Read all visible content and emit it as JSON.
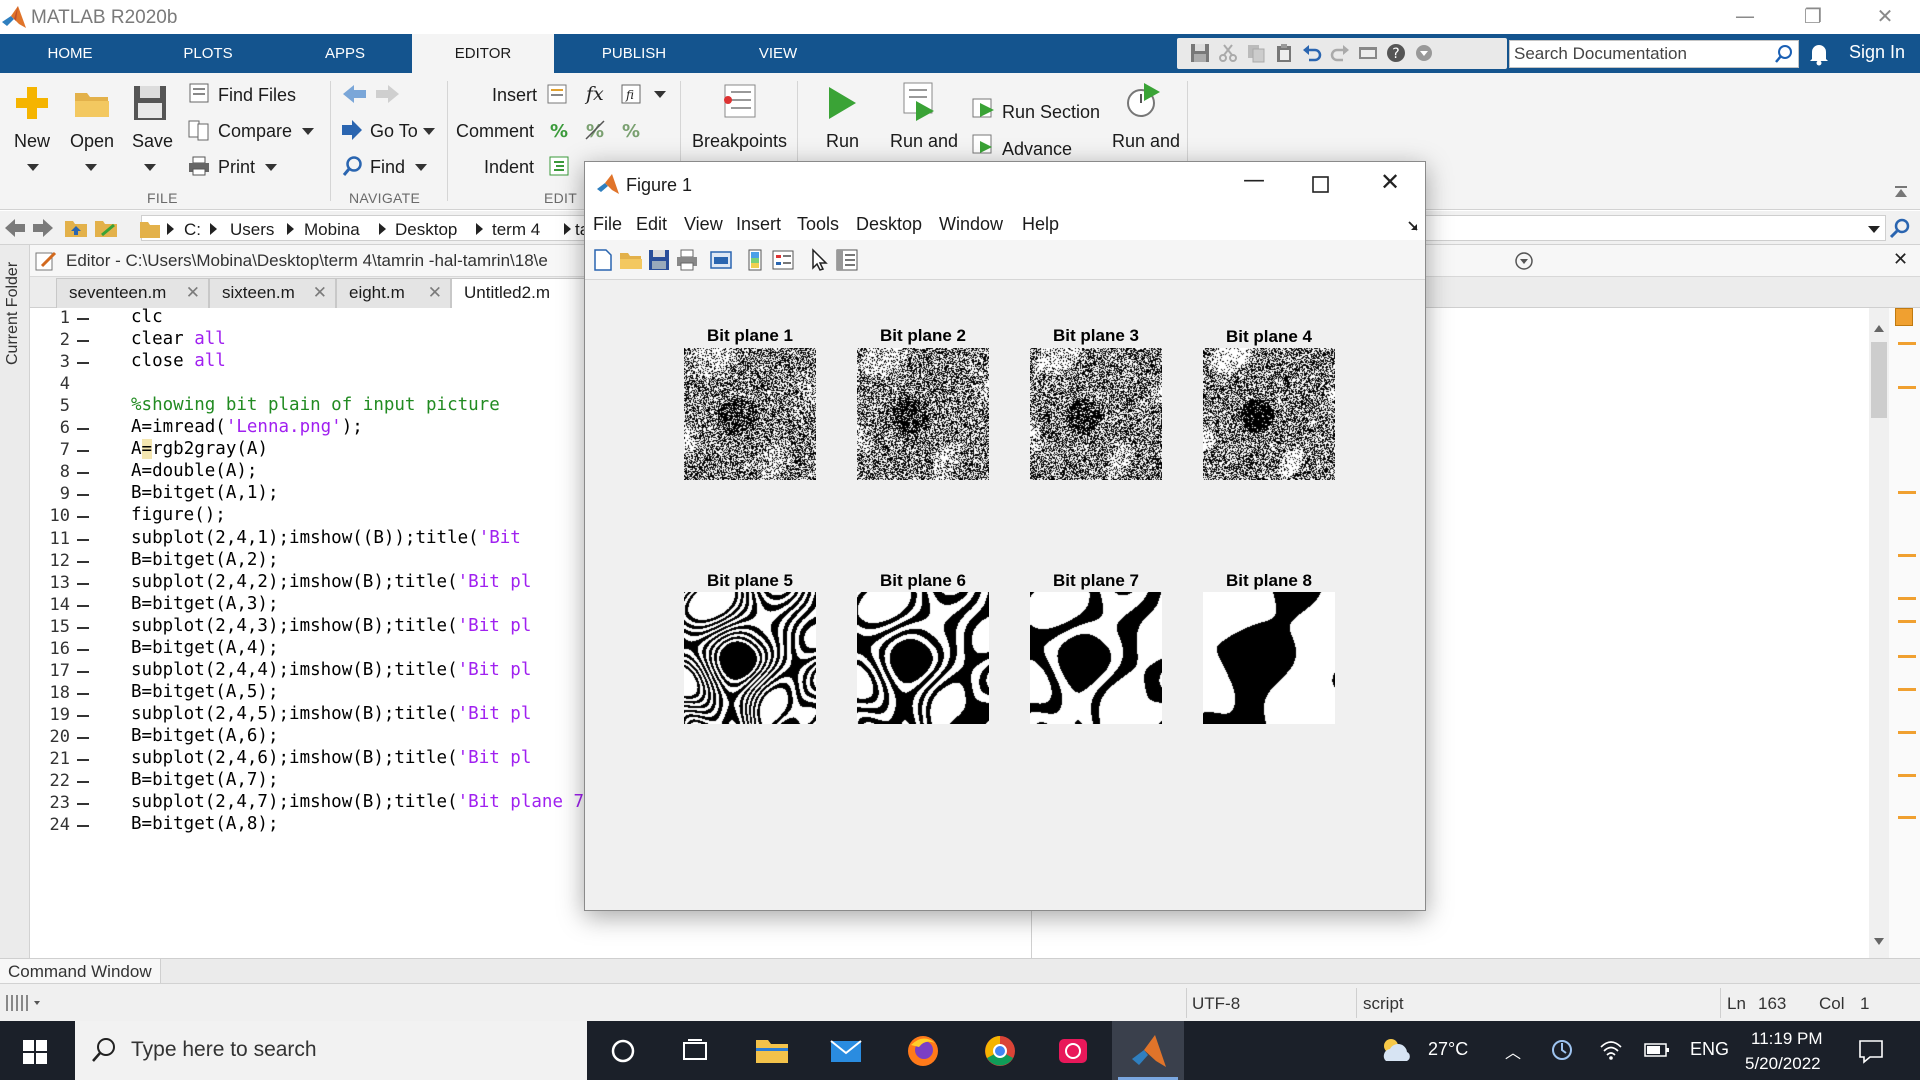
{
  "app": {
    "title": "MATLAB R2020b"
  },
  "ribbon_tabs": [
    "HOME",
    "PLOTS",
    "APPS",
    "EDITOR",
    "PUBLISH",
    "VIEW"
  ],
  "search_placeholder": "Search Documentation",
  "sign_in": "Sign In",
  "toolstrip": {
    "file": {
      "new": "New",
      "open": "Open",
      "save": "Save",
      "find_files": "Find Files",
      "compare": "Compare",
      "print": "Print",
      "section": "FILE"
    },
    "navigate": {
      "go_to": "Go To",
      "find": "Find",
      "section": "NAVIGATE"
    },
    "edit": {
      "insert": "Insert",
      "comment": "Comment",
      "indent": "Indent",
      "section": "EDIT"
    },
    "breakpoints": "Breakpoints",
    "run": {
      "run": "Run",
      "run_and_advance": "Run and",
      "run_section": "Run Section",
      "advance": "Advance",
      "run_and_time": "Run and"
    }
  },
  "address": {
    "crumbs": [
      "C:",
      "Users",
      "Mobina",
      "Desktop",
      "term 4",
      "ta"
    ]
  },
  "side_panel": "Current Folder",
  "editor": {
    "title": "Editor - C:\\Users\\Mobina\\Desktop\\term 4\\tamrin -hal-tamrin\\18\\e",
    "tabs": [
      "seventeen.m",
      "sixteen.m",
      "eight.m",
      "Untitled2.m"
    ],
    "lines": [
      {
        "n": "1",
        "text": "clc"
      },
      {
        "n": "2",
        "text": "clear ",
        "kw": "all"
      },
      {
        "n": "3",
        "text": "close ",
        "kw": "all"
      },
      {
        "n": "4",
        "text": ""
      },
      {
        "n": "5",
        "comment": "%showing bit plain of input picture"
      },
      {
        "n": "6",
        "pre": "A=imread(",
        "str": "'Lenna.png'",
        "post": ");"
      },
      {
        "n": "7",
        "cursor": "A",
        "cursor_ch": "=",
        "post": "rgb2gray(A)"
      },
      {
        "n": "8",
        "text": "A=double(A);"
      },
      {
        "n": "9",
        "text": "B=bitget(A,1);"
      },
      {
        "n": "10",
        "text": "figure();"
      },
      {
        "n": "11",
        "pre": "subplot(2,4,1);imshow((B));title(",
        "str": "'Bit"
      },
      {
        "n": "12",
        "text": "B=bitget(A,2);"
      },
      {
        "n": "13",
        "pre": "subplot(2,4,2);imshow(B);title(",
        "str": "'Bit pl"
      },
      {
        "n": "14",
        "text": "B=bitget(A,3);"
      },
      {
        "n": "15",
        "pre": "subplot(2,4,3);imshow(B);title(",
        "str": "'Bit pl"
      },
      {
        "n": "16",
        "text": "B=bitget(A,4);"
      },
      {
        "n": "17",
        "pre": "subplot(2,4,4);imshow(B);title(",
        "str": "'Bit pl"
      },
      {
        "n": "18",
        "text": "B=bitget(A,5);"
      },
      {
        "n": "19",
        "pre": "subplot(2,4,5);imshow(B);title(",
        "str": "'Bit pl"
      },
      {
        "n": "20",
        "text": "B=bitget(A,6);"
      },
      {
        "n": "21",
        "pre": "subplot(2,4,6);imshow(B);title(",
        "str": "'Bit pl"
      },
      {
        "n": "22",
        "text": "B=bitget(A,7);"
      },
      {
        "n": "23",
        "pre": "subplot(2,4,7);imshow(B);title(",
        "str": "'Bit plane 7'",
        "post": ");"
      },
      {
        "n": "24",
        "text": "B=bitget(A,8);"
      }
    ]
  },
  "command_window": "Command Window",
  "status": {
    "encoding": "UTF-8",
    "type": "script",
    "ln_label": "Ln",
    "ln": "163",
    "col_label": "Col",
    "col": "1"
  },
  "figure": {
    "title": "Figure 1",
    "menu": [
      "File",
      "Edit",
      "View",
      "Insert",
      "Tools",
      "Desktop",
      "Window",
      "Help"
    ],
    "subplots": [
      "Bit plane 1",
      "Bit plane 2",
      "Bit plane 3",
      "Bit plane 4",
      "Bit plane 5",
      "Bit plane 6",
      "Bit plane 7",
      "Bit plane 8"
    ]
  },
  "taskbar": {
    "search": "Type here to search",
    "weather": "27°C",
    "lang": "ENG",
    "time": "11:19 PM",
    "date": "5/20/2022"
  },
  "colors": {
    "tab_bar": "#14548e",
    "taskbar": "#1b2029",
    "string": "#a020f0",
    "comment": "#228b22"
  }
}
